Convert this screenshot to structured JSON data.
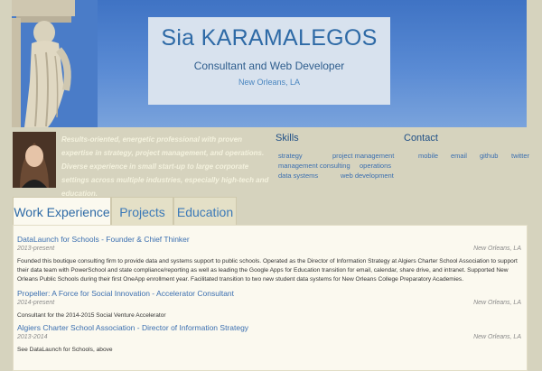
{
  "header": {
    "name": "Sia KARAMALEGOS",
    "role": "Consultant and Web Developer",
    "location": "New Orleans, LA"
  },
  "summary": "Results-oriented, energetic professional with proven expertise in strategy, project management, and operations. Diverse experience in small start-up to large corporate settings across multiple industries, especially high-tech and education.",
  "skills": {
    "heading": "Skills",
    "items": [
      "strategy",
      "project management",
      "management consulting",
      "operations",
      "data systems",
      "web development"
    ]
  },
  "contact": {
    "heading": "Contact",
    "links": [
      "mobile",
      "email",
      "github",
      "twitter"
    ]
  },
  "tabs": [
    {
      "label": "Work Experience",
      "active": true
    },
    {
      "label": "Projects",
      "active": false
    },
    {
      "label": "Education",
      "active": false
    }
  ],
  "jobs": [
    {
      "title": "DataLaunch for Schools - Founder & Chief Thinker",
      "dates": "2013-present",
      "location": "New Orleans, LA",
      "description": "Founded this boutique consulting firm to provide data and systems support to public schools. Operated as the Director of Information Strategy at Algiers Charter School Association to support their data team with PowerSchool and state compliance/reporting as well as leading the Google Apps for Education transition for email, calendar, share drive, and intranet. Supported New Orleans Public Schools during their first OneApp enrollment year. Facilitated transition to two new student data systems for New Orleans College Preparatory Academies."
    },
    {
      "title": "Propeller: A Force for Social Innovation - Accelerator Consultant",
      "dates": "2014-present",
      "location": "New Orleans, LA",
      "description": "Consultant for the 2014-2015 Social Venture Accelerator"
    },
    {
      "title": "Algiers Charter School Association - Director of Information Strategy",
      "dates": "2013-2014",
      "location": "New Orleans, LA",
      "description": "See DataLaunch for Schools, above"
    }
  ]
}
